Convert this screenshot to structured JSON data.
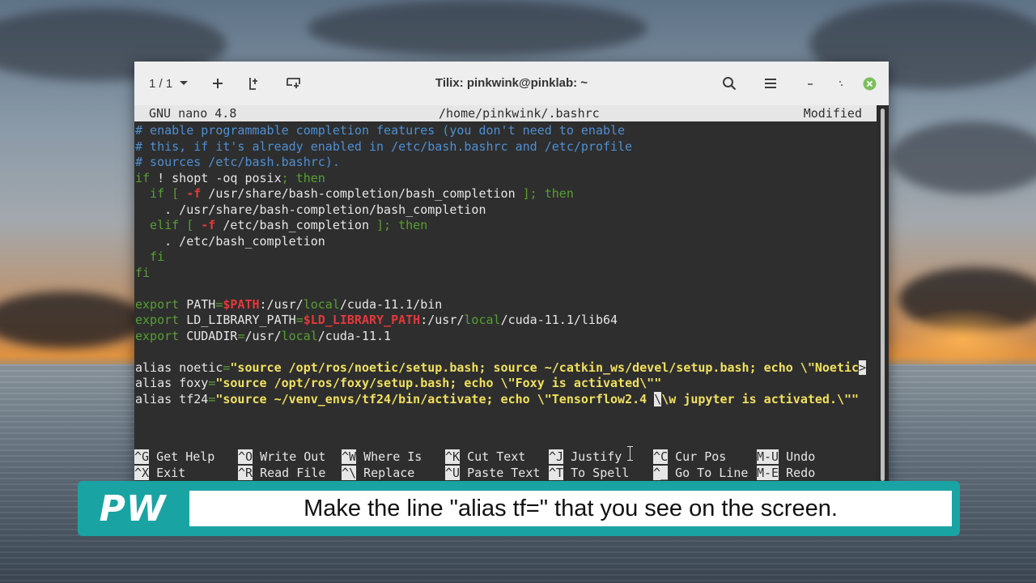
{
  "window": {
    "tab_counter": "1 / 1",
    "title": "Tilix: pinkwink@pinklab: ~"
  },
  "nano": {
    "version": "GNU nano 4.8",
    "filename": "/home/pinkwink/.bashrc",
    "status": "Modified"
  },
  "code_lines": [
    [
      {
        "t": "# enable programmable completion features (you don't need to enable",
        "c": "cmt"
      }
    ],
    [
      {
        "t": "# this, if it's already enabled in /etc/bash.bashrc and /etc/profile",
        "c": "cmt"
      }
    ],
    [
      {
        "t": "# sources /etc/bash.bashrc).",
        "c": "cmt"
      }
    ],
    [
      {
        "t": "if",
        "c": "kw"
      },
      {
        "t": " ! shopt -oq posix",
        "c": "txt"
      },
      {
        "t": "; then",
        "c": "kw"
      }
    ],
    [
      {
        "t": "  if",
        "c": "kw"
      },
      {
        "t": " [ ",
        "c": "kw"
      },
      {
        "t": "-f",
        "c": "var"
      },
      {
        "t": " /usr/share/bash-completion/bash_completion",
        "c": "txt"
      },
      {
        "t": " ]; then",
        "c": "kw"
      }
    ],
    [
      {
        "t": "    . /usr/share/bash-completion/bash_completion",
        "c": "txt"
      }
    ],
    [
      {
        "t": "  elif",
        "c": "kw"
      },
      {
        "t": " [ ",
        "c": "kw"
      },
      {
        "t": "-f",
        "c": "var"
      },
      {
        "t": " /etc/bash_completion",
        "c": "txt"
      },
      {
        "t": " ]; then",
        "c": "kw"
      }
    ],
    [
      {
        "t": "    . /etc/bash_completion",
        "c": "txt"
      }
    ],
    [
      {
        "t": "  fi",
        "c": "kw"
      }
    ],
    [
      {
        "t": "fi",
        "c": "kw"
      }
    ],
    [
      {
        "t": "",
        "c": "txt"
      }
    ],
    [
      {
        "t": "export",
        "c": "kw"
      },
      {
        "t": " PATH",
        "c": "txt"
      },
      {
        "t": "=",
        "c": "kw"
      },
      {
        "t": "$PATH",
        "c": "var"
      },
      {
        "t": ":/usr/",
        "c": "txt"
      },
      {
        "t": "local",
        "c": "kw"
      },
      {
        "t": "/cuda-11.1/bin",
        "c": "txt"
      }
    ],
    [
      {
        "t": "export",
        "c": "kw"
      },
      {
        "t": " LD_LIBRARY_PATH",
        "c": "txt"
      },
      {
        "t": "=",
        "c": "kw"
      },
      {
        "t": "$LD_LIBRARY_PATH",
        "c": "var"
      },
      {
        "t": ":/usr/",
        "c": "txt"
      },
      {
        "t": "local",
        "c": "kw"
      },
      {
        "t": "/cuda-11.1/lib64",
        "c": "txt"
      }
    ],
    [
      {
        "t": "export",
        "c": "kw"
      },
      {
        "t": " CUDADIR",
        "c": "txt"
      },
      {
        "t": "=",
        "c": "kw"
      },
      {
        "t": "/usr/",
        "c": "txt"
      },
      {
        "t": "local",
        "c": "kw"
      },
      {
        "t": "/cuda-11.1",
        "c": "txt"
      }
    ],
    [
      {
        "t": "",
        "c": "txt"
      }
    ],
    [
      {
        "t": "alias noetic",
        "c": "txt"
      },
      {
        "t": "=",
        "c": "kw"
      },
      {
        "t": "\"source /opt/ros/noetic/setup.bash; source ~/catkin_ws/devel/setup.bash; echo \\\"Noetic",
        "c": "str"
      },
      {
        "t": ">",
        "c": "trunc"
      }
    ],
    [
      {
        "t": "alias foxy",
        "c": "txt"
      },
      {
        "t": "=",
        "c": "kw"
      },
      {
        "t": "\"source /opt/ros/foxy/setup.bash; echo \\\"Foxy is activated\\\"\"",
        "c": "str"
      }
    ],
    [
      {
        "t": "alias tf24",
        "c": "txt"
      },
      {
        "t": "=",
        "c": "kw"
      },
      {
        "t": "\"source ~/venv_envs/tf24/bin/activate; echo \\\"Tensorflow2.4 ",
        "c": "str"
      },
      {
        "t": "\\",
        "c": "cur"
      },
      {
        "t": "\\w jupyter is activated.\\\"\"",
        "c": "str"
      }
    ]
  ],
  "shortcuts_row1": [
    {
      "key": "^G",
      "label": "Get Help"
    },
    {
      "key": "^O",
      "label": "Write Out"
    },
    {
      "key": "^W",
      "label": "Where Is"
    },
    {
      "key": "^K",
      "label": "Cut Text"
    },
    {
      "key": "^J",
      "label": "Justify"
    },
    {
      "key": "^C",
      "label": "Cur Pos"
    },
    {
      "key": "M-U",
      "label": "Undo"
    }
  ],
  "shortcuts_row2": [
    {
      "key": "^X",
      "label": "Exit"
    },
    {
      "key": "^R",
      "label": "Read File"
    },
    {
      "key": "^\\",
      "label": "Replace"
    },
    {
      "key": "^U",
      "label": "Paste Text"
    },
    {
      "key": "^T",
      "label": "To Spell"
    },
    {
      "key": "^_",
      "label": "Go To Line"
    },
    {
      "key": "M-E",
      "label": "Redo"
    }
  ],
  "subtitle": {
    "logo": "PW",
    "text": "Make the line \"alias tf=\" that you see on the screen."
  }
}
